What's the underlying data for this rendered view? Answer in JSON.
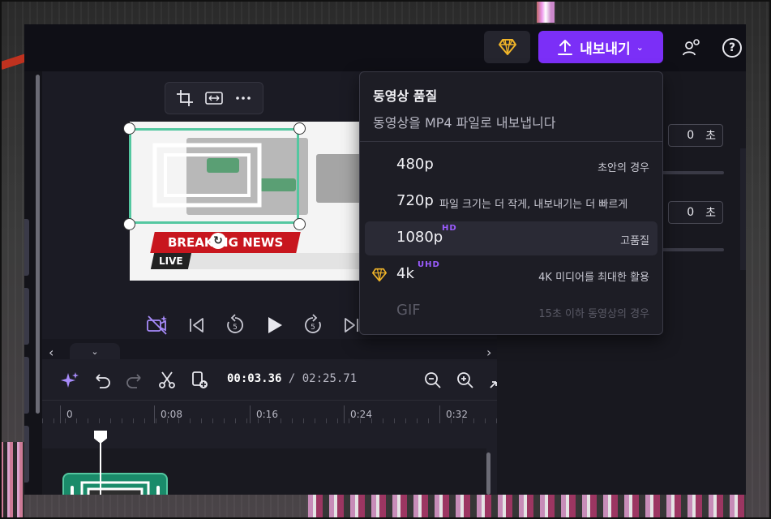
{
  "topbar": {
    "export_label": "내보내기",
    "export_chevron": "⌄",
    "help_glyph": "?"
  },
  "video": {
    "headline": "BREAKING NEWS",
    "live_label": "LIVE"
  },
  "timeline": {
    "current_time": "00:03.36",
    "separator": " / ",
    "total_time": "02:25.71",
    "ruler_labels": [
      "0",
      "0:08",
      "0:16",
      "0:24",
      "0:32"
    ]
  },
  "right_panel": {
    "field1_value": "0",
    "field1_unit": "초",
    "field2_value": "0",
    "field2_unit": "초"
  },
  "quality_menu": {
    "title": "동영상 품질",
    "subtitle": "동영상을 MP4 파일로 내보냅니다",
    "options": [
      {
        "label": "480p",
        "badge": "",
        "desc": "초안의 경우",
        "premium": false,
        "disabled": false,
        "active": false
      },
      {
        "label": "720p",
        "badge": "",
        "desc": "파일 크기는 더 작게, 내보내기는 더 빠르게",
        "premium": false,
        "disabled": false,
        "active": false
      },
      {
        "label": "1080p",
        "badge": "HD",
        "desc": "고품질",
        "premium": false,
        "disabled": false,
        "active": true
      },
      {
        "label": "4k",
        "badge": "UHD",
        "desc": "4K 미디어를 최대한 활용",
        "premium": true,
        "disabled": false,
        "active": false
      },
      {
        "label": "GIF",
        "badge": "",
        "desc": "15초 이하 동영상의 경우",
        "premium": false,
        "disabled": true,
        "active": false
      }
    ]
  },
  "colors": {
    "accent_purple": "#7b2ff7",
    "selection_green": "#54c7a0",
    "premium_gold": "#f0b429",
    "news_red": "#c8161e"
  }
}
